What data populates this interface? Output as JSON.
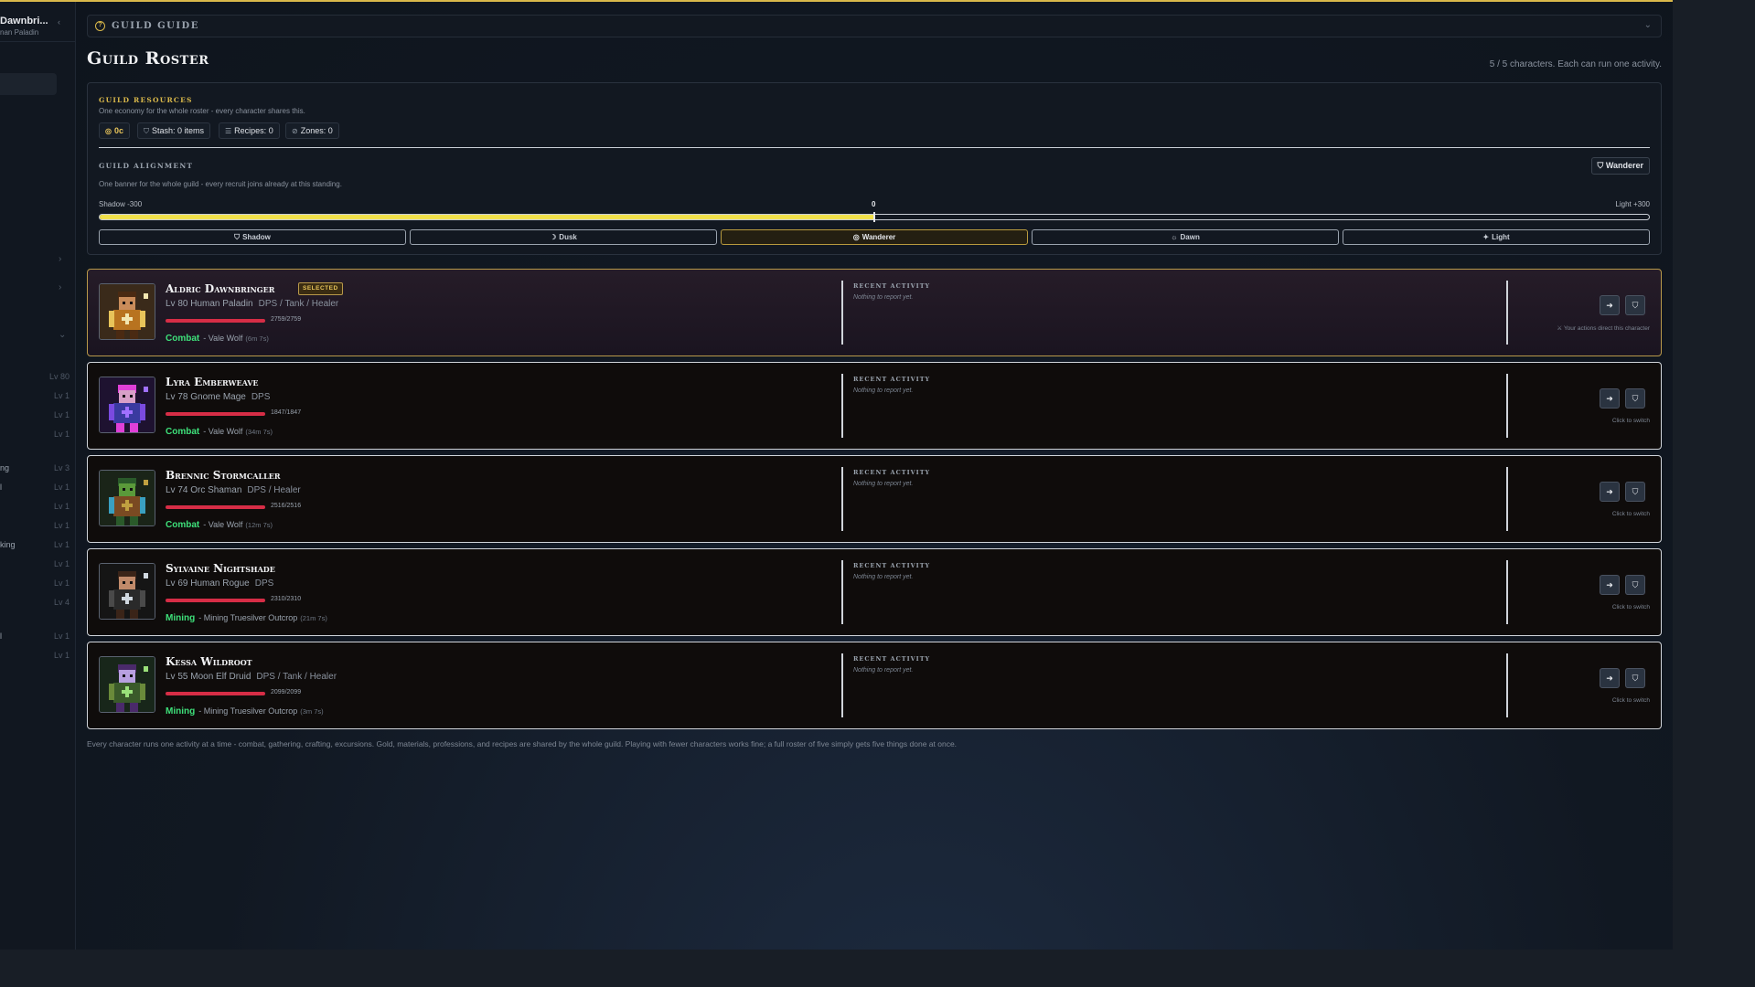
{
  "sidebar": {
    "name": "Dawnbri...",
    "subtitle": "nan Paladin",
    "rows": [
      {
        "label": "",
        "level": "Lv 80"
      },
      {
        "label": "",
        "level": "Lv 1"
      },
      {
        "label": "",
        "level": "Lv 1"
      },
      {
        "label": "",
        "level": "Lv 1"
      },
      {
        "label": "ng",
        "level": "Lv 3"
      },
      {
        "label": "l",
        "level": "Lv 1"
      },
      {
        "label": "",
        "level": "Lv 1"
      },
      {
        "label": "",
        "level": "Lv 1"
      },
      {
        "label": "king",
        "level": "Lv 1"
      },
      {
        "label": "",
        "level": "Lv 1"
      },
      {
        "label": "",
        "level": "Lv 1"
      },
      {
        "label": "",
        "level": "Lv 4"
      },
      {
        "label": "l",
        "level": "Lv 1"
      },
      {
        "label": "",
        "level": "Lv 1"
      }
    ]
  },
  "guide": {
    "title": "GUILD GUIDE"
  },
  "page": {
    "title": "Guild Roster",
    "count": "5 / 5 characters. Each can run one activity."
  },
  "resources": {
    "title": "GUILD RESOURCES",
    "desc": "One economy for the whole roster - every character shares this.",
    "chips": {
      "gold": "0c",
      "stash": "Stash: 0 items",
      "recipes": "Recipes: 0",
      "zones": "Zones: 0"
    }
  },
  "alignment": {
    "title": "GUILD ALIGNMENT",
    "desc": "One banner for the whole guild - every recruit joins already at this standing.",
    "current": "Wanderer",
    "min_label": "Shadow -300",
    "zero_label": "0",
    "max_label": "Light +300",
    "value": 0,
    "min": -300,
    "max": 300,
    "options": [
      "Shadow",
      "Dusk",
      "Wanderer",
      "Dawn",
      "Light"
    ]
  },
  "characters": [
    {
      "name": "Aldric Dawnbringer",
      "selected": true,
      "badge": "SELECTED",
      "level_line": "Lv 80 Human Paladin",
      "roles": "DPS / Tank / Healer",
      "hp": "2759/2759",
      "hp_fraction": 1.0,
      "activity": "Combat",
      "location": "- Vale Wolf",
      "time": "(6m 7s)",
      "recent_title": "RECENT ACTIVITY",
      "recent_text": "Nothing to report yet.",
      "note": "Your actions direct this character"
    },
    {
      "name": "Lyra Emberweave",
      "selected": false,
      "level_line": "Lv 78 Gnome Mage",
      "roles": "DPS",
      "hp": "1847/1847",
      "hp_fraction": 1.0,
      "activity": "Combat",
      "location": "- Vale Wolf",
      "time": "(34m 7s)",
      "recent_title": "RECENT ACTIVITY",
      "recent_text": "Nothing to report yet.",
      "note": "Click to switch"
    },
    {
      "name": "Brennic Stormcaller",
      "selected": false,
      "level_line": "Lv 74 Orc Shaman",
      "roles": "DPS / Healer",
      "hp": "2516/2516",
      "hp_fraction": 1.0,
      "activity": "Combat",
      "location": "- Vale Wolf",
      "time": "(12m 7s)",
      "recent_title": "RECENT ACTIVITY",
      "recent_text": "Nothing to report yet.",
      "note": "Click to switch"
    },
    {
      "name": "Sylvaine Nightshade",
      "selected": false,
      "level_line": "Lv 69 Human Rogue",
      "roles": "DPS",
      "hp": "2310/2310",
      "hp_fraction": 1.0,
      "activity": "Mining",
      "location": "- Mining Truesilver Outcrop",
      "time": "(21m 7s)",
      "recent_title": "RECENT ACTIVITY",
      "recent_text": "Nothing to report yet.",
      "note": "Click to switch"
    },
    {
      "name": "Kessa Wildroot",
      "selected": false,
      "level_line": "Lv 55 Moon Elf Druid",
      "roles": "DPS / Tank / Healer",
      "hp": "2099/2099",
      "hp_fraction": 1.0,
      "activity": "Mining",
      "location": "- Mining Truesilver Outcrop",
      "time": "(3m 7s)",
      "recent_title": "RECENT ACTIVITY",
      "recent_text": "Nothing to report yet.",
      "note": "Click to switch"
    }
  ],
  "footer": "Every character runs one activity at a time - combat, gathering, crafting, excursions. Gold, materials, professions, and recipes are shared by the whole guild. Playing with fewer characters works fine; a full roster of five simply gets five things done at once.",
  "colors": {
    "accent": "#d9b84a",
    "hp": "#d62d46",
    "activity": "#3ee07a",
    "alignment_fill": "#f0e04a"
  }
}
